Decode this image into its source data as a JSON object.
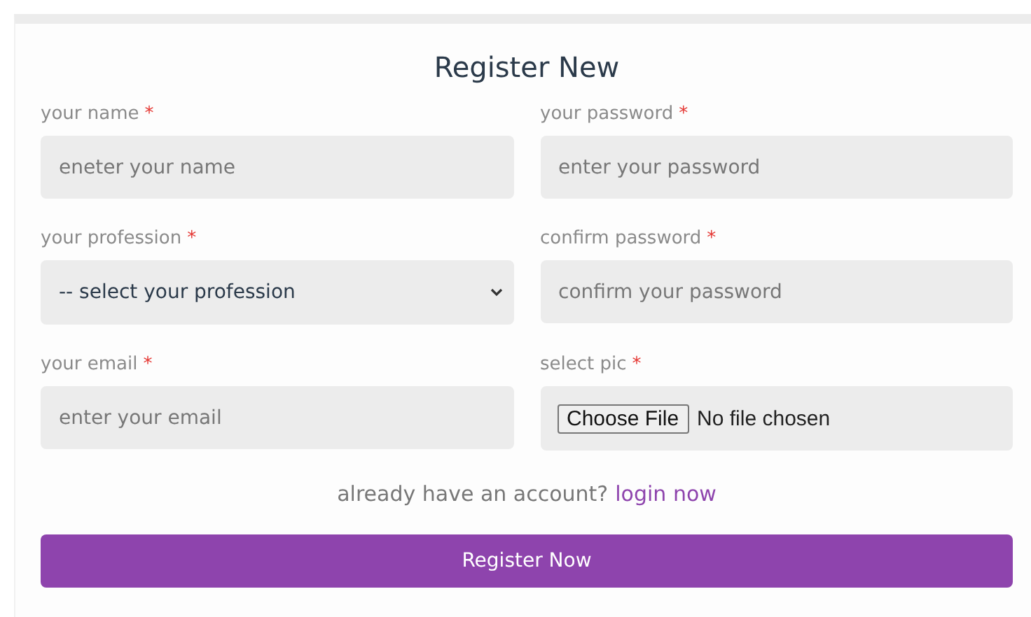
{
  "title": "Register New",
  "fields": [
    {
      "kind": "text",
      "label": "your name",
      "required": "*",
      "placeholder": "eneter your name"
    },
    {
      "kind": "text",
      "label": "your password",
      "required": "*",
      "placeholder": "enter your password"
    },
    {
      "kind": "select",
      "label": "your profession",
      "required": "*",
      "value": "-- select your profession"
    },
    {
      "kind": "text",
      "label": "confirm password",
      "required": "*",
      "placeholder": "confirm your password"
    },
    {
      "kind": "text",
      "label": "your email",
      "required": "*",
      "placeholder": "enter your email"
    },
    {
      "kind": "file",
      "label": "select pic",
      "required": "*",
      "button": "Choose File",
      "status": "No file chosen"
    }
  ],
  "login_prompt": {
    "text": "already have an account?",
    "link": "login now"
  },
  "submit": "Register Now"
}
